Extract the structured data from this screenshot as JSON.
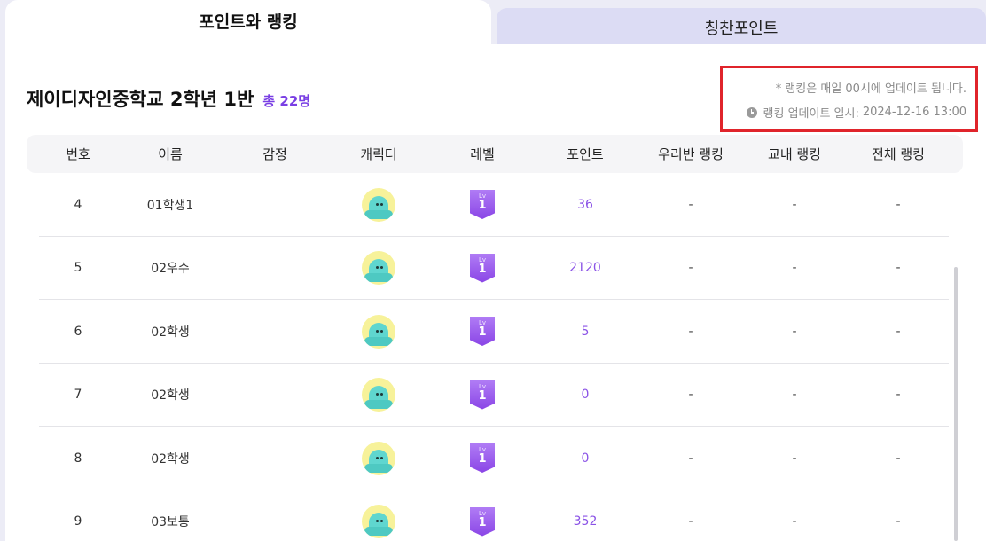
{
  "tabs": [
    {
      "label": "포인트와 랭킹",
      "active": true
    },
    {
      "label": "칭찬포인트",
      "active": false
    }
  ],
  "class_title": "제이디자인중학교 2학년 1반",
  "total_count": "총 22명",
  "notice": {
    "line1": "* 랭킹은 매일 00시에 업데이트 됩니다.",
    "line2_label": "랭킹 업데이트 일시:",
    "line2_value": "2024-12-16 13:00",
    "icon": "clock-icon"
  },
  "columns": [
    "번호",
    "이름",
    "감정",
    "캐릭터",
    "레벨",
    "포인트",
    "우리반 랭킹",
    "교내 랭킹",
    "전체 랭킹"
  ],
  "rows": [
    {
      "number": "4",
      "name": "01학생1",
      "emotion": "",
      "level_prefix": "Lv",
      "level": "1",
      "points": "36",
      "class_rank": "-",
      "school_rank": "-",
      "total_rank": "-"
    },
    {
      "number": "5",
      "name": "02우수",
      "emotion": "",
      "level_prefix": "Lv",
      "level": "1",
      "points": "2120",
      "class_rank": "-",
      "school_rank": "-",
      "total_rank": "-"
    },
    {
      "number": "6",
      "name": "02학생",
      "emotion": "",
      "level_prefix": "Lv",
      "level": "1",
      "points": "5",
      "class_rank": "-",
      "school_rank": "-",
      "total_rank": "-"
    },
    {
      "number": "7",
      "name": "02학생",
      "emotion": "",
      "level_prefix": "Lv",
      "level": "1",
      "points": "0",
      "class_rank": "-",
      "school_rank": "-",
      "total_rank": "-"
    },
    {
      "number": "8",
      "name": "02학생",
      "emotion": "",
      "level_prefix": "Lv",
      "level": "1",
      "points": "0",
      "class_rank": "-",
      "school_rank": "-",
      "total_rank": "-"
    },
    {
      "number": "9",
      "name": "03보통",
      "emotion": "",
      "level_prefix": "Lv",
      "level": "1",
      "points": "352",
      "class_rank": "-",
      "school_rank": "-",
      "total_rank": "-"
    }
  ],
  "colors": {
    "accent": "#7a3fe4",
    "points": "#8a52e6",
    "highlight_border": "#e0242b",
    "inactive_tab": "#dcdcf4"
  }
}
